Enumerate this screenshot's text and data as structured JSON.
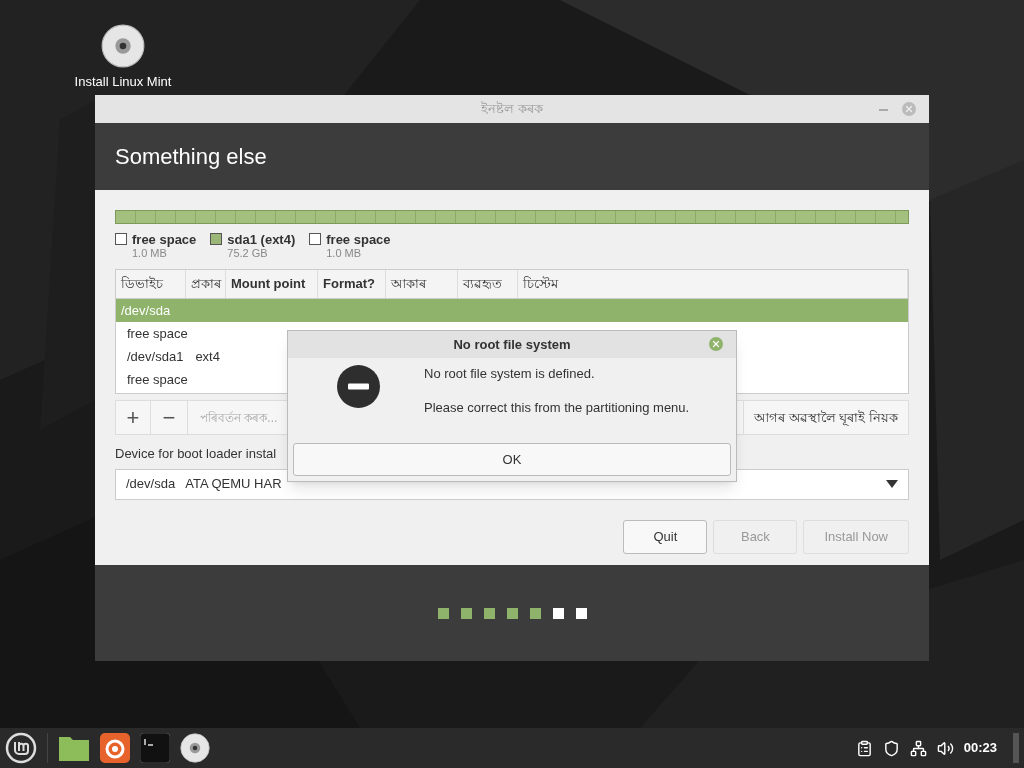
{
  "desktop_icons": [
    {
      "label": "Install Linux Mint"
    }
  ],
  "window": {
    "title": "ইনষ্টল কৰক",
    "heading": "Something else",
    "legend": [
      {
        "label": "free space",
        "size": "1.0 MB",
        "color": "#ffffff"
      },
      {
        "label": "sda1 (ext4)",
        "size": "75.2 GB",
        "color": "#9bb677"
      },
      {
        "label": "free space",
        "size": "1.0 MB",
        "color": "#ffffff"
      }
    ],
    "table": {
      "columns": [
        "ডিভাইচ",
        "প্ৰকাৰ",
        "Mount point",
        "Format?",
        "আকাৰ",
        "ব্যৱহৃত",
        "চিস্টেম"
      ],
      "rows": [
        {
          "device": "/dev/sda",
          "selected": true,
          "children": [
            {
              "device": "free space",
              "selected": false
            },
            {
              "device": "/dev/sda1",
              "type": "ext4",
              "selected": false
            },
            {
              "device": "free space",
              "selected": false
            }
          ]
        }
      ]
    },
    "toolbar": {
      "add": "+",
      "remove": "−",
      "change": {
        "label": "পৰিবৰ্তন কৰক...",
        "disabled": true
      },
      "revert": {
        "label": "আগৰ অৱস্থালৈ ঘূৰাই  নিয়ক",
        "disabled": false
      }
    },
    "boot_loader": {
      "label": "Device for boot loader instal",
      "value": "/dev/sda   ATA QEMU HAR"
    },
    "buttons": [
      {
        "label": "Quit",
        "disabled": false
      },
      {
        "label": "Back",
        "disabled": true
      },
      {
        "label": "Install Now",
        "disabled": true
      }
    ],
    "steps": [
      {
        "done": true
      },
      {
        "done": true
      },
      {
        "done": true
      },
      {
        "done": true
      },
      {
        "done": true
      },
      {
        "done": false
      },
      {
        "done": false
      }
    ]
  },
  "dialog": {
    "title": "No root file system",
    "message": "No root file system is defined.",
    "detail": "Please correct this from the partitioning menu.",
    "ok": "OK"
  },
  "taskbar": {
    "clock": "00:23"
  }
}
